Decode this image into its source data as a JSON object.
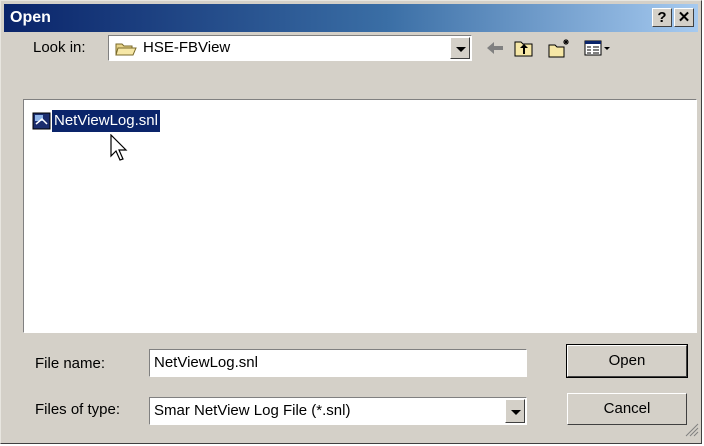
{
  "window": {
    "title": "Open",
    "help_glyph": "?",
    "close_glyph": "✕"
  },
  "toolbar": {
    "look_in_label": "Look in:",
    "look_in_value": "HSE-FBView",
    "look_in_icon": "folder-open-icon",
    "back_icon": "back-arrow-icon",
    "up_icon": "up-one-level-icon",
    "new_folder_icon": "new-folder-icon",
    "view_menu_icon": "view-menu-icon"
  },
  "files": [
    {
      "name": "NetViewLog.snl",
      "icon": "snl-file-icon",
      "selected": true
    }
  ],
  "footer": {
    "file_name_label": "File name:",
    "file_name_value": "NetViewLog.snl",
    "files_of_type_label": "Files of type:",
    "files_of_type_value": "Smar NetView Log File (*.snl)",
    "open_button": "Open",
    "cancel_button": "Cancel"
  },
  "colors": {
    "title_bar_start": "#0a246a",
    "title_bar_end": "#a6caf0",
    "selection": "#0a246a",
    "dialog_face": "#d4d0c8"
  }
}
